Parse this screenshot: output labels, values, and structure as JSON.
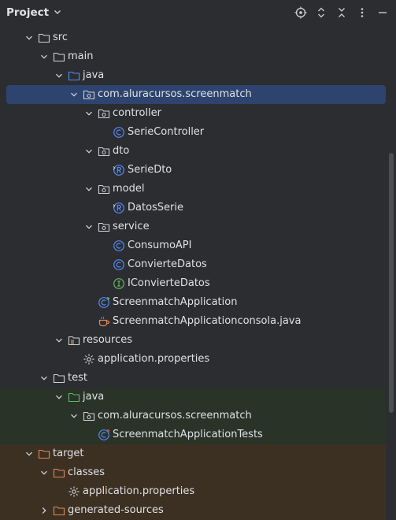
{
  "header": {
    "title": "Project"
  },
  "tree": [
    {
      "label": "src",
      "depth": 0,
      "expanded": true,
      "icon": "folder"
    },
    {
      "label": "main",
      "depth": 1,
      "expanded": true,
      "icon": "folder"
    },
    {
      "label": "java",
      "depth": 2,
      "expanded": true,
      "icon": "source-folder"
    },
    {
      "label": "com.aluracursos.screenmatch",
      "depth": 3,
      "expanded": true,
      "icon": "package",
      "selected": true
    },
    {
      "label": "controller",
      "depth": 4,
      "expanded": true,
      "icon": "package"
    },
    {
      "label": "SerieController",
      "depth": 5,
      "icon": "class"
    },
    {
      "label": "dto",
      "depth": 4,
      "expanded": true,
      "icon": "package"
    },
    {
      "label": "SerieDto",
      "depth": 5,
      "icon": "record"
    },
    {
      "label": "model",
      "depth": 4,
      "expanded": true,
      "icon": "package"
    },
    {
      "label": "DatosSerie",
      "depth": 5,
      "icon": "record"
    },
    {
      "label": "service",
      "depth": 4,
      "expanded": true,
      "icon": "package"
    },
    {
      "label": "ConsumoAPI",
      "depth": 5,
      "icon": "class"
    },
    {
      "label": "ConvierteDatos",
      "depth": 5,
      "icon": "class"
    },
    {
      "label": "IConvierteDatos",
      "depth": 5,
      "icon": "interface"
    },
    {
      "label": "ScreenmatchApplication",
      "depth": 4,
      "icon": "spring-app"
    },
    {
      "label": "ScreenmatchApplicationconsola.java",
      "depth": 4,
      "icon": "java-file"
    },
    {
      "label": "resources",
      "depth": 2,
      "expanded": true,
      "icon": "resources-folder"
    },
    {
      "label": "application.properties",
      "depth": 3,
      "icon": "gear"
    },
    {
      "label": "test",
      "depth": 1,
      "expanded": true,
      "icon": "folder"
    },
    {
      "label": "java",
      "depth": 2,
      "expanded": true,
      "icon": "test-folder",
      "bg": "test"
    },
    {
      "label": "com.aluracursos.screenmatch",
      "depth": 3,
      "expanded": true,
      "icon": "package",
      "bg": "test"
    },
    {
      "label": "ScreenmatchApplicationTests",
      "depth": 4,
      "icon": "spring-test",
      "bg": "test"
    },
    {
      "label": "target",
      "depth": 0,
      "expanded": true,
      "icon": "excluded-folder",
      "bg": "target"
    },
    {
      "label": "classes",
      "depth": 1,
      "expanded": true,
      "icon": "excluded-folder",
      "bg": "target"
    },
    {
      "label": "application.properties",
      "depth": 2,
      "icon": "gear",
      "bg": "target"
    },
    {
      "label": "generated-sources",
      "depth": 1,
      "expanded": false,
      "icon": "excluded-folder",
      "bg": "target"
    }
  ]
}
